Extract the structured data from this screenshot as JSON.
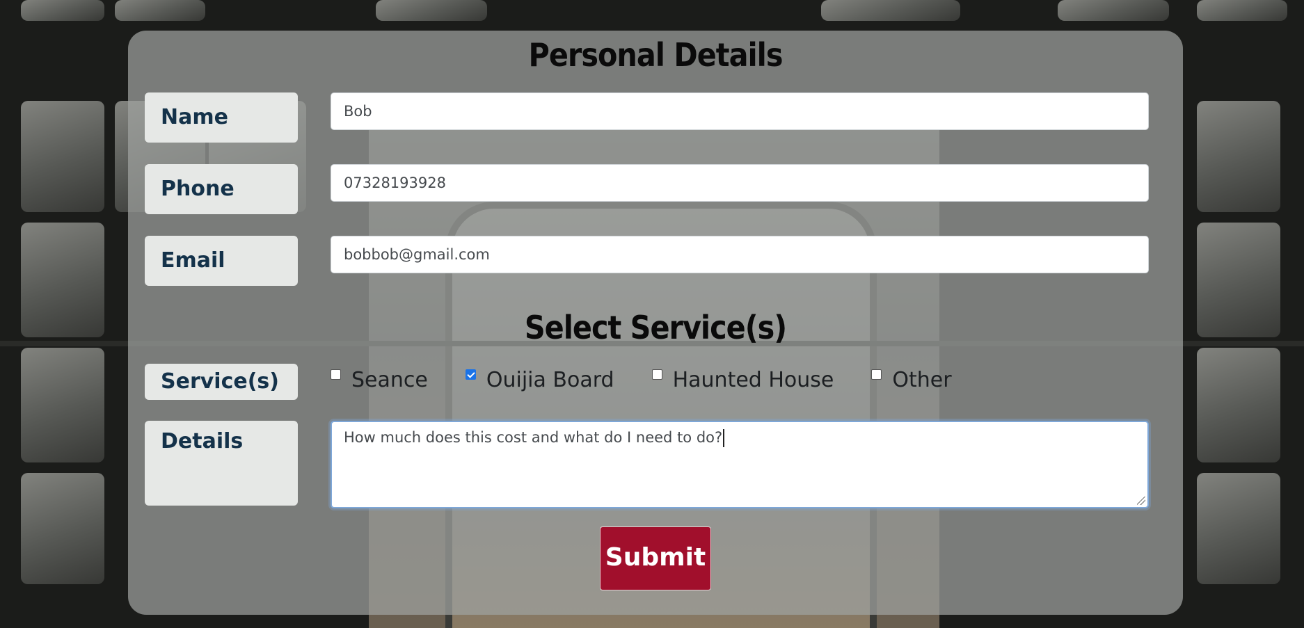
{
  "form": {
    "personal_heading": "Personal Details",
    "services_heading": "Select Service(s)",
    "fields": {
      "name": {
        "label": "Name",
        "value": "Bob"
      },
      "phone": {
        "label": "Phone",
        "value": "07328193928"
      },
      "email": {
        "label": "Email",
        "value": "bobbob@gmail.com"
      }
    },
    "services_label": "Service(s)",
    "services": [
      {
        "label": "Seance",
        "checked": false
      },
      {
        "label": "Ouijia Board",
        "checked": true
      },
      {
        "label": "Haunted House",
        "checked": false
      },
      {
        "label": "Other",
        "checked": false
      }
    ],
    "details_label": "Details",
    "details_value": "How much does this cost and what do I need to do?",
    "submit_label": "Submit"
  },
  "colors": {
    "submit_bg": "#a10f2c",
    "label_text": "#14324a",
    "checkbox_checked": "#1a73e8"
  }
}
